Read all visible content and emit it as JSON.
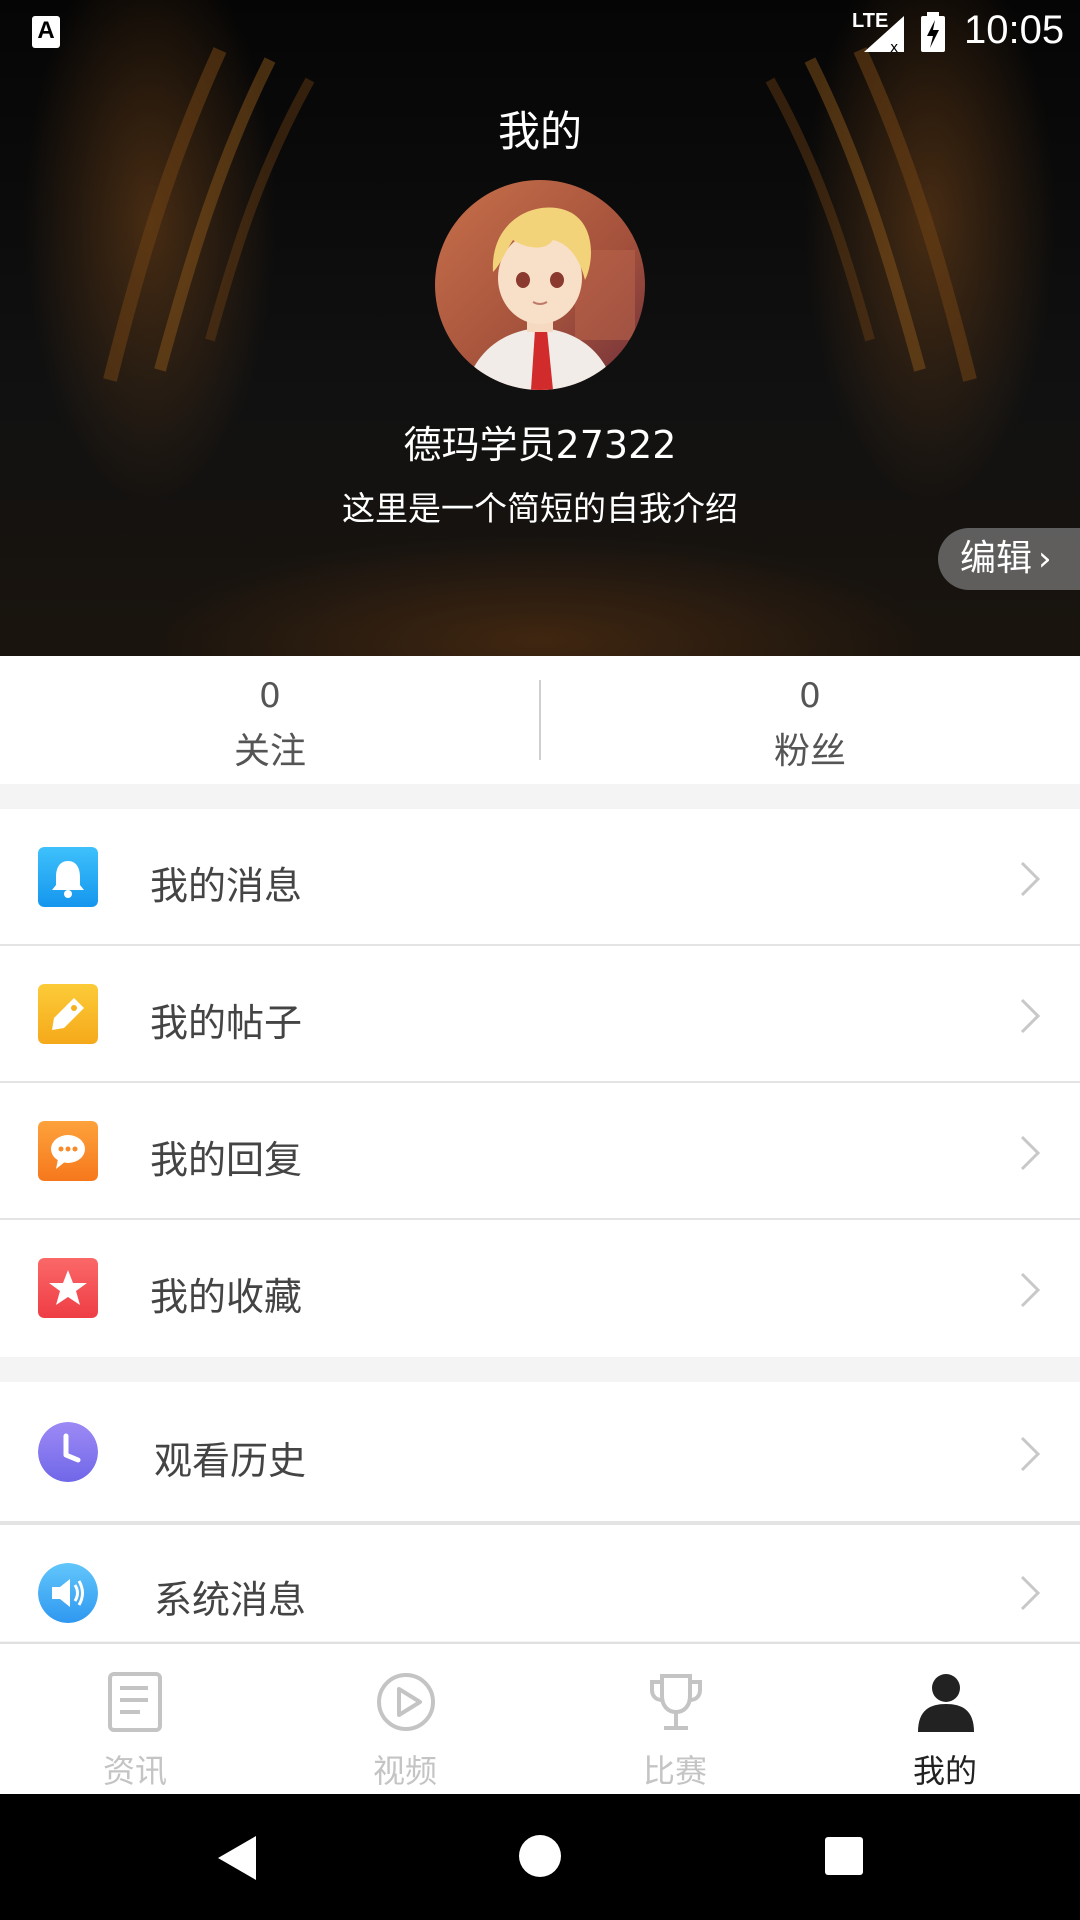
{
  "status_bar": {
    "app_indicator": "A",
    "network": "LTE",
    "time": "10:05"
  },
  "header": {
    "title": "我的",
    "username": "德玛学员27322",
    "bio": "这里是一个简短的自我介绍",
    "edit_label": "编辑"
  },
  "stats": {
    "following": {
      "count": "0",
      "label": "关注"
    },
    "fans": {
      "count": "0",
      "label": "粉丝"
    }
  },
  "menu_groups": [
    [
      {
        "label": "我的消息",
        "icon": "bell-icon",
        "color": "#2aa9f5"
      },
      {
        "label": "我的帖子",
        "icon": "tag-icon",
        "color": "#f7b928"
      },
      {
        "label": "我的回复",
        "icon": "chat-bubble-icon",
        "color": "#f98b2a"
      },
      {
        "label": "我的收藏",
        "icon": "star-icon",
        "color": "#f25454"
      }
    ],
    [
      {
        "label": "观看历史",
        "icon": "clock-icon",
        "color": "#8a7cf0"
      },
      {
        "label": "系统消息",
        "icon": "speaker-icon",
        "color": "#41adf4"
      }
    ]
  ],
  "tabs": [
    {
      "label": "资讯",
      "icon": "news-icon",
      "active": false
    },
    {
      "label": "视频",
      "icon": "play-icon",
      "active": false
    },
    {
      "label": "比赛",
      "icon": "trophy-icon",
      "active": false
    },
    {
      "label": "我的",
      "icon": "person-icon",
      "active": true
    }
  ],
  "colors": {
    "inactive_tab": "#c4c4c4",
    "active_tab": "#222222"
  }
}
